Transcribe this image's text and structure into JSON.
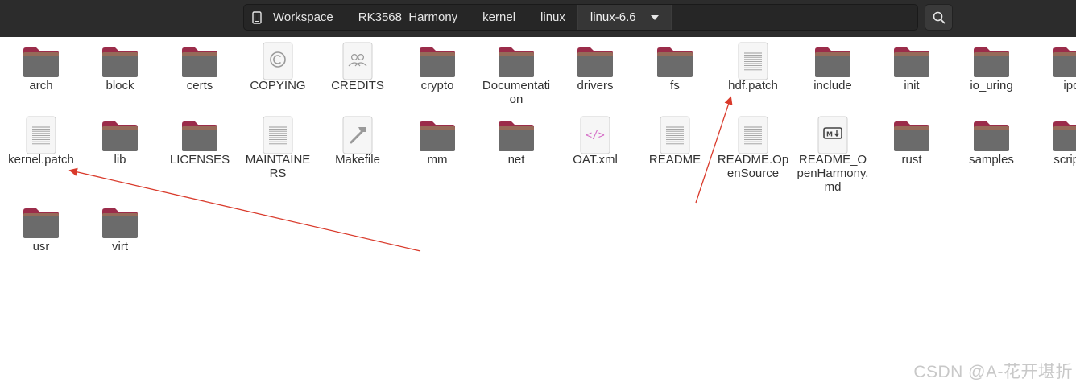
{
  "pathbar": {
    "crumbs": [
      "Workspace",
      "RK3568_Harmony",
      "kernel",
      "linux",
      "linux-6.6"
    ]
  },
  "files": [
    {
      "name": "arch",
      "type": "folder"
    },
    {
      "name": "block",
      "type": "folder"
    },
    {
      "name": "certs",
      "type": "folder"
    },
    {
      "name": "COPYING",
      "type": "copyright"
    },
    {
      "name": "CREDITS",
      "type": "people"
    },
    {
      "name": "crypto",
      "type": "folder"
    },
    {
      "name": "Documentation",
      "type": "folder"
    },
    {
      "name": "drivers",
      "type": "folder"
    },
    {
      "name": "fs",
      "type": "folder"
    },
    {
      "name": "hdf.patch",
      "type": "text"
    },
    {
      "name": "include",
      "type": "folder"
    },
    {
      "name": "init",
      "type": "folder"
    },
    {
      "name": "io_uring",
      "type": "folder"
    },
    {
      "name": "ipc",
      "type": "folder"
    },
    {
      "name": "kernel.patch",
      "type": "text"
    },
    {
      "name": "lib",
      "type": "folder"
    },
    {
      "name": "LICENSES",
      "type": "folder"
    },
    {
      "name": "MAINTAINERS",
      "type": "text"
    },
    {
      "name": "Makefile",
      "type": "make"
    },
    {
      "name": "mm",
      "type": "folder"
    },
    {
      "name": "net",
      "type": "folder"
    },
    {
      "name": "OAT.xml",
      "type": "xml"
    },
    {
      "name": "README",
      "type": "text"
    },
    {
      "name": "README.OpenSource",
      "type": "text"
    },
    {
      "name": "README_OpenHarmony.md",
      "type": "markdown"
    },
    {
      "name": "rust",
      "type": "folder"
    },
    {
      "name": "samples",
      "type": "folder"
    },
    {
      "name": "scripts",
      "type": "folder"
    },
    {
      "name": "usr",
      "type": "folder"
    },
    {
      "name": "virt",
      "type": "folder"
    }
  ],
  "watermark": "CSDN @A-花开堪折",
  "colors": {
    "folder_tab": "#9b2c4a",
    "folder_body": "#6b6b6b",
    "annotation_arrow": "#d93a2b",
    "header_bg": "#2c2c2c"
  }
}
